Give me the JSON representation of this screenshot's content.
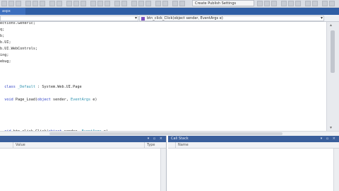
{
  "toolbar": {
    "config_combo": "Create Publish Settings"
  },
  "tab": {
    "label": "aspx",
    "close_icon": "close-icon"
  },
  "navbar": {
    "member_selector": "btn_click_Click(object sender, EventArgs e)"
  },
  "code": {
    "lines": [
      {
        "parts": [
          {
            "t": "ections.Generic;",
            "c": ""
          }
        ]
      },
      {
        "parts": [
          {
            "t": "q;",
            "c": ""
          }
        ]
      },
      {
        "parts": [
          {
            "t": "b;",
            "c": ""
          }
        ]
      },
      {
        "parts": [
          {
            "t": "b.UI;",
            "c": ""
          }
        ]
      },
      {
        "parts": [
          {
            "t": "b.UI.WebControls;",
            "c": ""
          }
        ]
      },
      {
        "parts": [
          {
            "t": "ing;",
            "c": ""
          }
        ]
      },
      {
        "parts": [
          {
            "t": "ebug;",
            "c": ""
          }
        ]
      },
      {
        "parts": [
          {
            "t": "",
            "c": ""
          }
        ]
      },
      {
        "parts": [
          {
            "t": "",
            "c": ""
          }
        ]
      },
      {
        "parts": [
          {
            "t": "",
            "c": ""
          }
        ]
      },
      {
        "parts": [
          {
            "t": "  class ",
            "c": "kw"
          },
          {
            "t": "_Default",
            "c": "ty"
          },
          {
            "t": " : System.Web.UI.Page",
            "c": ""
          }
        ]
      },
      {
        "parts": [
          {
            "t": "",
            "c": ""
          }
        ]
      },
      {
        "parts": [
          {
            "t": "  void",
            "c": "kw"
          },
          {
            "t": " Page_Load(",
            "c": ""
          },
          {
            "t": "object",
            "c": "kw"
          },
          {
            "t": " sender, ",
            "c": ""
          },
          {
            "t": "EventArgs",
            "c": "ty"
          },
          {
            "t": " e)",
            "c": ""
          }
        ]
      },
      {
        "parts": [
          {
            "t": "",
            "c": ""
          }
        ]
      },
      {
        "parts": [
          {
            "t": "",
            "c": ""
          }
        ]
      },
      {
        "parts": [
          {
            "t": "",
            "c": ""
          }
        ]
      },
      {
        "parts": [
          {
            "t": "",
            "c": ""
          }
        ]
      },
      {
        "parts": [
          {
            "t": "  oid",
            "c": "kw"
          },
          {
            "t": " btn_click_Click(",
            "c": ""
          },
          {
            "t": "object",
            "c": "kw"
          },
          {
            "t": " sender, ",
            "c": ""
          },
          {
            "t": "EventArgs",
            "c": "ty"
          },
          {
            "t": " e)",
            "c": ""
          }
        ]
      }
    ]
  },
  "panels": {
    "left": {
      "title": "",
      "columns": [
        "Value",
        "Type"
      ]
    },
    "right": {
      "title": "Call Stack",
      "columns": [
        "Name"
      ]
    }
  },
  "colors": {
    "tab_strip": "#2f5ea5",
    "panel_title": "#3a5f9c",
    "keyword": "#2c3fc4",
    "type": "#2b91af"
  }
}
